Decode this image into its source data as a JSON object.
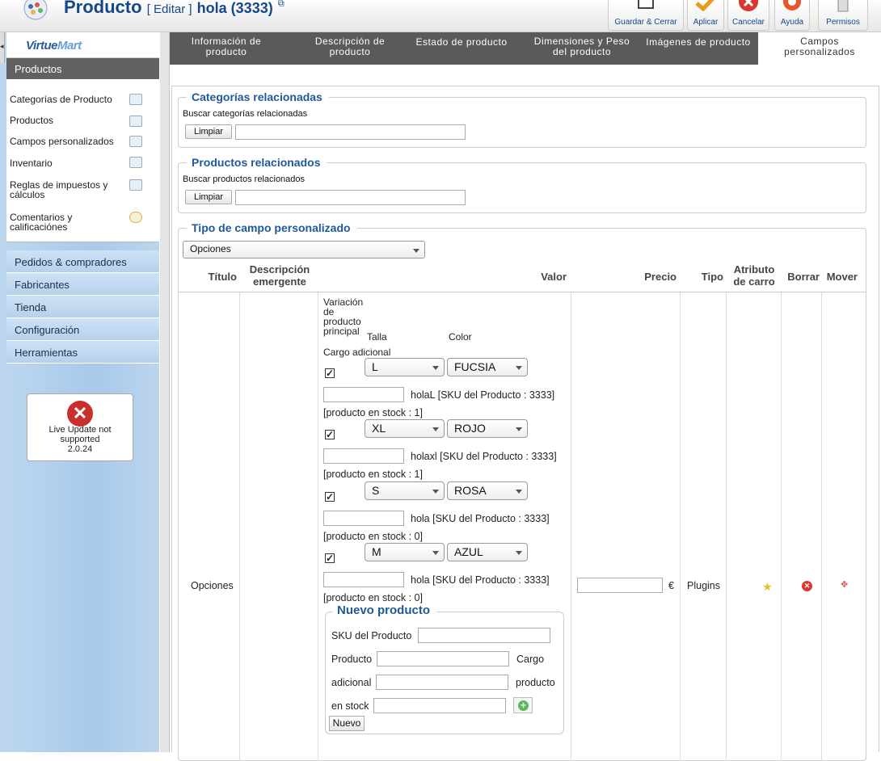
{
  "header": {
    "title": "Producto",
    "edit_label": "[ Editar ]",
    "product_name": "hola (3333)",
    "toolbar": [
      {
        "label": "Guardar & Cerrar",
        "icon": "save-icon"
      },
      {
        "label": "Aplicar",
        "icon": "check-icon"
      },
      {
        "label": "Cancelar",
        "icon": "cancel-icon"
      },
      {
        "label": "Ayuda",
        "icon": "help-icon"
      },
      {
        "label": "Permisos",
        "icon": "permissions-icon"
      }
    ]
  },
  "sidebar": {
    "logo_text_a": "Virtue",
    "logo_text_b": "Mart",
    "active_section": "Productos",
    "items": [
      {
        "label": "Categorías de Producto",
        "icon": "category-icon"
      },
      {
        "label": "Productos",
        "icon": "products-icon"
      },
      {
        "label": "Campos personalizados",
        "icon": "custom-fields-icon"
      },
      {
        "label": "Inventario",
        "icon": "inventory-icon"
      },
      {
        "label": "Reglas de impuestos y cálculos",
        "icon": "tax-icon"
      },
      {
        "label": "Comentarios y calificaciónes",
        "icon": "comments-icon"
      }
    ],
    "sections": [
      "Pedidos & compradores",
      "Fabricantes",
      "Tienda",
      "Configuración",
      "Herramientas"
    ],
    "live_update": {
      "line1": "Live Update not",
      "line2": "supported",
      "version": "2.0.24"
    }
  },
  "tabs": [
    {
      "l1": "Información de",
      "l2": "producto"
    },
    {
      "l1": "Descripción de",
      "l2": "producto"
    },
    {
      "l1": "Estado de producto",
      "l2": ""
    },
    {
      "l1": "Dimensiones y Peso",
      "l2": "del producto"
    },
    {
      "l1": "Imágenes de producto",
      "l2": ""
    },
    {
      "l1": "Campos",
      "l2": "personalizados"
    }
  ],
  "categorias": {
    "legend": "Categorías relacionadas",
    "label": "Buscar categorías relacionadas",
    "clear": "Limpiar",
    "value": ""
  },
  "productos": {
    "legend": "Productos relacionados",
    "label": "Buscar productos relacionados",
    "clear": "Limpiar",
    "value": ""
  },
  "tipo": {
    "legend": "Tipo de campo personalizado",
    "selected": "Opciones",
    "headers": {
      "titulo": "Título",
      "desc1": "Descripción",
      "desc2": "emergente",
      "valor": "Valor",
      "precio": "Precio",
      "tipo": "Tipo",
      "atrib1": "Atributo",
      "atrib2": "de carro",
      "borrar": "Borrar",
      "mover": "Mover"
    },
    "row": {
      "titulo": "Opciones",
      "precio_currency": "€",
      "tipo": "Plugins",
      "valor": {
        "intro1": "Variación",
        "intro2": "de",
        "intro3": "producto",
        "intro4": "principal",
        "col_talla": "Talla",
        "col_color": "Color",
        "cargo": "Cargo adicional",
        "variants": [
          {
            "check": "✓",
            "talla": "L",
            "color": "FUCSIA",
            "name": "holaL [SKU del Producto : 3333]",
            "stock": "[producto en stock : 1]"
          },
          {
            "check": "✓",
            "talla": "XL",
            "color": "ROJO",
            "name": "holaxl [SKU del Producto : 3333]",
            "stock": "[producto en stock : 1]"
          },
          {
            "check": "✓",
            "talla": "S",
            "color": "ROSA",
            "name": "hola [SKU del Producto : 3333]",
            "stock": "[producto en stock : 0]"
          },
          {
            "check": "✓",
            "talla": "M",
            "color": "AZUL",
            "name": "hola [SKU del Producto : 3333]",
            "stock": "[producto en stock : 0]"
          }
        ],
        "nuevo": {
          "legend": "Nuevo producto",
          "sku_label": "SKU del Producto",
          "producto_label": "Producto",
          "cargo1": "Cargo",
          "cargo2": "adicional",
          "producto2": "producto",
          "stock_label": "en stock",
          "nuevo_btn": "Nuevo"
        }
      }
    }
  },
  "colors": {
    "brand": "#15488a",
    "tabbar": "#5a5a5a",
    "legend": "#1f5997",
    "sidebar": "#a9c9ea"
  }
}
